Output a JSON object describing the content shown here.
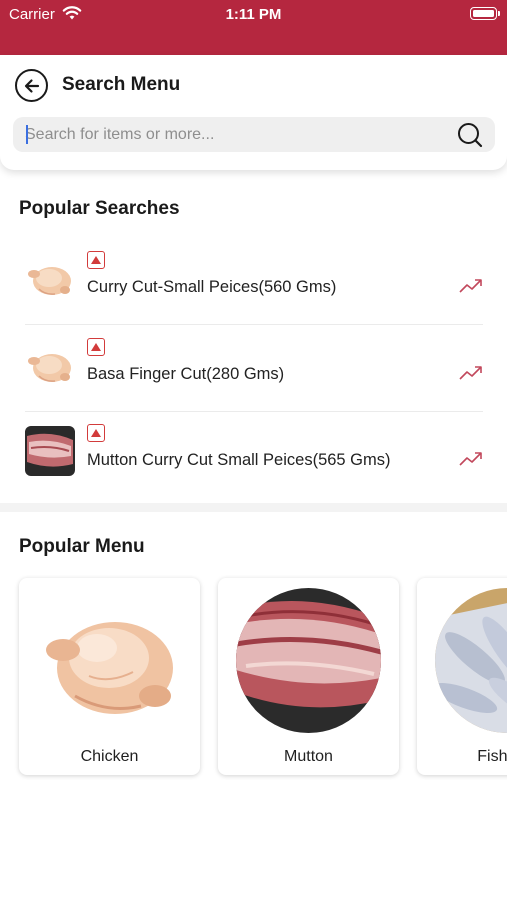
{
  "status_bar": {
    "carrier": "Carrier",
    "time": "1:11 PM"
  },
  "header": {
    "title": "Search Menu"
  },
  "search": {
    "placeholder": "Search for items or more..."
  },
  "popular_searches": {
    "title": "Popular Searches",
    "items": [
      {
        "name": "Curry Cut-Small Peices(560 Gms)",
        "image": "chicken"
      },
      {
        "name": "Basa Finger Cut(280 Gms)",
        "image": "chicken"
      },
      {
        "name": "Mutton Curry Cut Small Peices(565 Gms)",
        "image": "mutton"
      }
    ]
  },
  "popular_menu": {
    "title": "Popular Menu",
    "items": [
      {
        "label": "Chicken",
        "image": "chicken"
      },
      {
        "label": "Mutton",
        "image": "mutton"
      },
      {
        "label": "Fish & S",
        "image": "fish"
      }
    ]
  },
  "colors": {
    "brand": "#b5273f",
    "non_veg_mark": "#d23b3b",
    "trend": "#c2485c"
  }
}
